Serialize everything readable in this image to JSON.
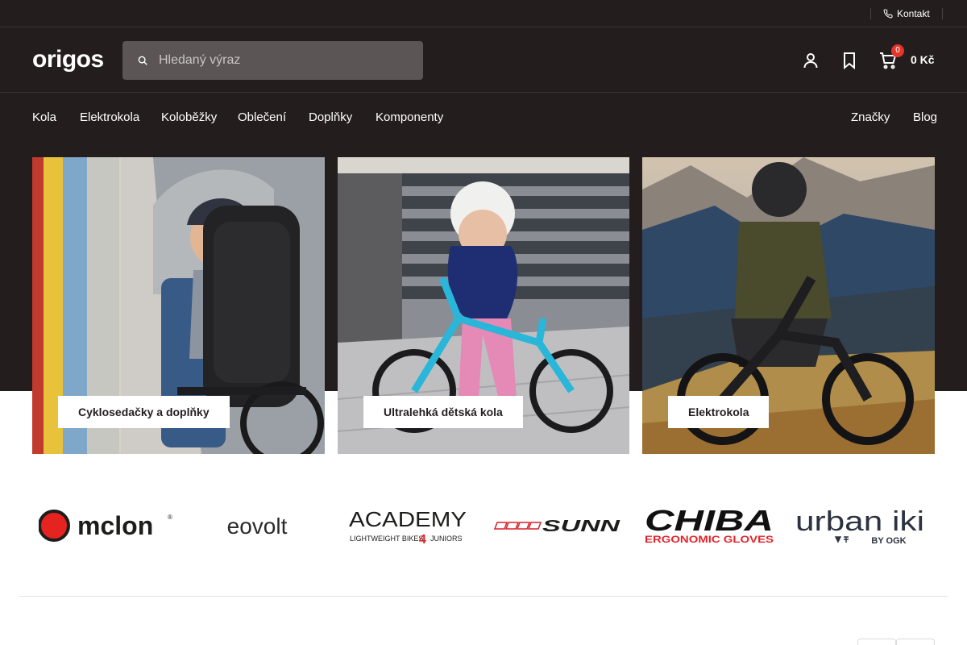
{
  "topbar": {
    "contact_label": "Kontakt"
  },
  "header": {
    "logo_text": "origos",
    "search_placeholder": "Hledaný výraz",
    "cart_count": "0",
    "cart_total": "0 Kč"
  },
  "nav": {
    "left": [
      "Kola",
      "Elektrokola",
      "Koloběžky",
      "Oblečení",
      "Doplňky",
      "Komponenty"
    ],
    "right": [
      "Značky",
      "Blog"
    ]
  },
  "hero": {
    "cards": [
      {
        "label": "Cyklosedačky a doplňky"
      },
      {
        "label": "Ultralehká dětská kola"
      },
      {
        "label": "Elektrokola"
      }
    ]
  },
  "brands": {
    "melon": "mclon",
    "eovolt": "eovolt",
    "academy": "ACADEMY",
    "academy_sub_left": "LIGHTWEIGHT BIKES",
    "academy_sub_num": "4",
    "academy_sub_right": "JUNIORS",
    "sunn": "SUNN",
    "chiba": "CHIBA",
    "chiba_sub": "ERGONOMIC GLOVES",
    "urban": "urban iki",
    "urban_sub": "BY OGK"
  },
  "colors": {
    "dark_background": "#241d1e",
    "search_background": "#5b5556",
    "badge": "#e5352b",
    "melon_red": "#e52320",
    "sunn_red": "#d7202a",
    "chiba_red": "#e3232b"
  }
}
